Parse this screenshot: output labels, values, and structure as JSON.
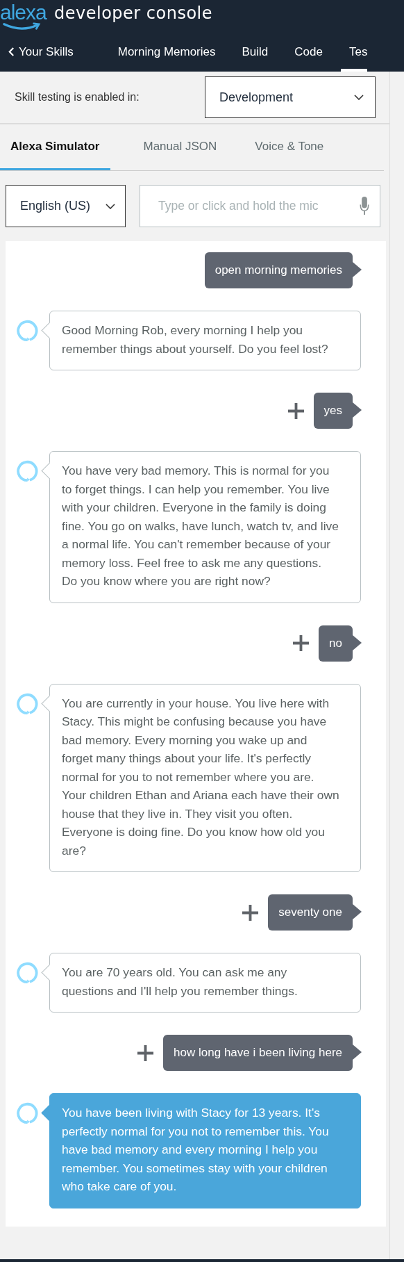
{
  "header": {
    "logo": "alexa",
    "title": "developer console"
  },
  "nav": [
    {
      "label": "Your Skills",
      "kind": "back",
      "selected": false
    },
    {
      "label": "Morning Memories",
      "kind": "plain",
      "selected": false
    },
    {
      "label": "Build",
      "kind": "plain",
      "selected": false
    },
    {
      "label": "Code",
      "kind": "plain",
      "selected": false
    },
    {
      "label": "Tes",
      "kind": "plain",
      "selected": true
    }
  ],
  "stage": {
    "label": "Skill testing is enabled in:",
    "value": "Development"
  },
  "tabs": [
    {
      "label": "Alexa Simulator",
      "selected": true
    },
    {
      "label": "Manual JSON",
      "selected": false
    },
    {
      "label": "Voice & Tone",
      "selected": false
    }
  ],
  "locale": {
    "value": "English (US)"
  },
  "utterance": {
    "placeholder": "Type or click and hold the mic"
  },
  "messages": [
    {
      "kind": "user",
      "text": "open morning memories",
      "add_button": false
    },
    {
      "kind": "alexa",
      "text": "Good Morning Rob, every morning I help you remember things about yourself. Do you feel lost?",
      "selected": false
    },
    {
      "kind": "user",
      "text": "yes",
      "add_button": true
    },
    {
      "kind": "alexa",
      "text": "You have very bad memory. This is normal for you to forget things. I can help you remember. You live with your children. Everyone in the family is doing fine. You go on walks, have lunch, watch tv, and live a normal life. You can't remember because of your memory loss. Feel free to ask me any questions. Do you know where you are right now?",
      "selected": false
    },
    {
      "kind": "user",
      "text": "no",
      "add_button": true
    },
    {
      "kind": "alexa",
      "text": "You are currently in your house. You live here with Stacy. This might be confusing because you have bad memory. Every morning you wake up and forget many things about your life. It's perfectly normal for you to not remember where you are. Your children Ethan and Ariana each have their own house that they live in. They visit you often. Everyone is doing fine. Do you know how old you are?",
      "selected": false
    },
    {
      "kind": "user",
      "text": "seventy one",
      "add_button": true
    },
    {
      "kind": "alexa",
      "text": "You are 70 years old. You can ask me any questions and I'll help you remember things.",
      "selected": false
    },
    {
      "kind": "user",
      "text": "how long have i been living here",
      "add_button": true
    },
    {
      "kind": "alexa",
      "text": "You have been living with Stacy for 13 years. It's perfectly normal for you not to remember this. You have bad memory and every morning I help you remember. You sometimes stay with your children who take care of you.",
      "selected": true
    }
  ]
}
